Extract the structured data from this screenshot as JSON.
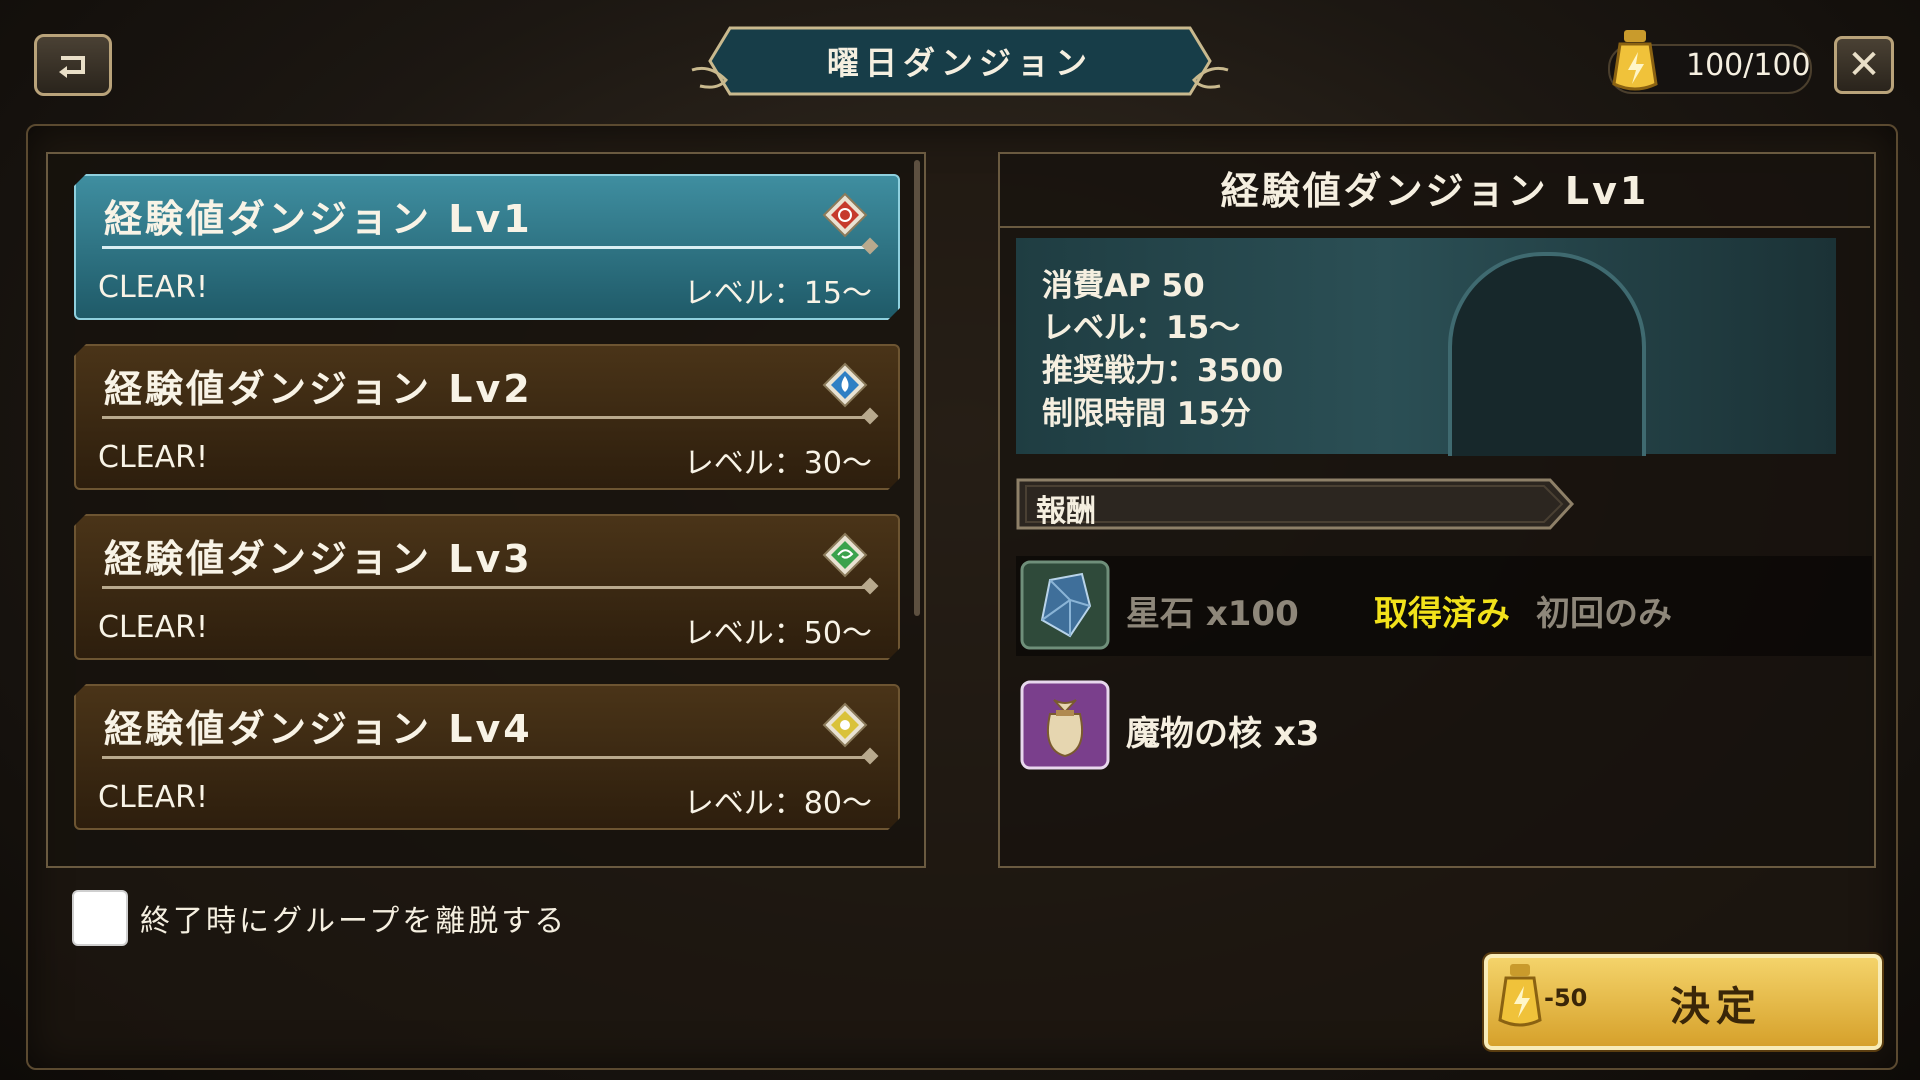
{
  "header": {
    "title": "曜日ダンジョン",
    "ap": "100/100"
  },
  "dungeon_list": [
    {
      "name": "経験値ダンジョン Lv1",
      "status": "CLEAR!",
      "level": "レベル：15〜",
      "element": "fire",
      "selected": true
    },
    {
      "name": "経験値ダンジョン Lv2",
      "status": "CLEAR!",
      "level": "レベル：30〜",
      "element": "water",
      "selected": false
    },
    {
      "name": "経験値ダンジョン Lv3",
      "status": "CLEAR!",
      "level": "レベル：50〜",
      "element": "wind",
      "selected": false
    },
    {
      "name": "経験値ダンジョン Lv4",
      "status": "CLEAR!",
      "level": "レベル：80〜",
      "element": "light",
      "selected": false
    }
  ],
  "detail": {
    "title": "経験値ダンジョン Lv1",
    "info": [
      "消費AP 50",
      "レベル：15〜",
      "推奨戦力：3500",
      "制限時間 15分"
    ],
    "reward_header": "報酬",
    "rewards": [
      {
        "name": "星石 x100",
        "acquired": "取得済み",
        "note": "初回のみ",
        "icon": "star-stone-icon"
      },
      {
        "name": "魔物の核 x3",
        "icon": "monster-core-bag-icon"
      }
    ]
  },
  "footer": {
    "leave_group_label": "終了時にグループを離脱する",
    "leave_group_checked": false,
    "decide_cost": "-50",
    "decide_label": "決定"
  },
  "colors": {
    "selected_row": "#2f7888",
    "row": "#3b2913",
    "acquired_text": "#f2e21b",
    "decide_button": "#e8bd48"
  }
}
